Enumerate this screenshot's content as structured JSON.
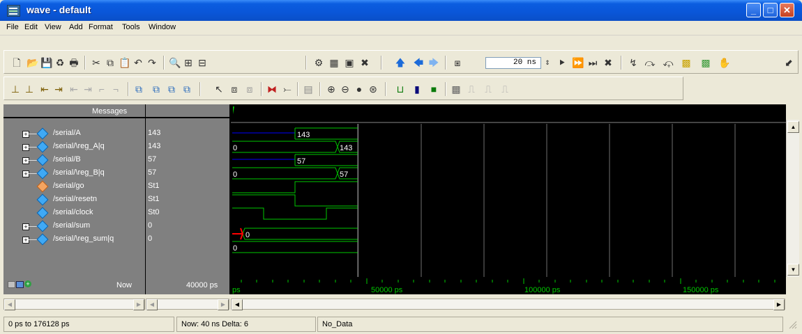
{
  "window": {
    "title": "wave - default"
  },
  "menu": [
    "File",
    "Edit",
    "View",
    "Add",
    "Format",
    "Tools",
    "Window"
  ],
  "toolbar": {
    "zoom_value": "20 ns"
  },
  "panes": {
    "messages_header": "Messages"
  },
  "signals": [
    {
      "name": "/serial/A",
      "value": "143",
      "icon": "bus-signal-icon",
      "expandable": true
    },
    {
      "name": "/serial/\\reg_A|q",
      "value": "143",
      "icon": "bus-signal-icon",
      "expandable": true
    },
    {
      "name": "/serial/B",
      "value": "57",
      "icon": "bus-signal-icon",
      "expandable": true
    },
    {
      "name": "/serial/\\reg_B|q",
      "value": "57",
      "icon": "bus-signal-icon",
      "expandable": true
    },
    {
      "name": "/serial/go",
      "value": "St1",
      "icon": "input-signal-icon",
      "expandable": false
    },
    {
      "name": "/serial/resetn",
      "value": "St1",
      "icon": "input-signal-icon",
      "expandable": false
    },
    {
      "name": "/serial/clock",
      "value": "St0",
      "icon": "input-signal-icon",
      "expandable": false
    },
    {
      "name": "/serial/sum",
      "value": "0",
      "icon": "bus-signal-icon",
      "expandable": true
    },
    {
      "name": "/serial/\\reg_sum|q",
      "value": "0",
      "icon": "bus-signal-icon",
      "expandable": true
    }
  ],
  "waves": {
    "A_label": "143",
    "reg_A_labels": [
      "0",
      "143"
    ],
    "B_label": "57",
    "reg_B_labels": [
      "0",
      "57"
    ],
    "sum_label": "0",
    "reg_sum_label": "0"
  },
  "timeline": {
    "now_label": "Now",
    "now_value": "40000 ps",
    "left_fragment": "ps",
    "ticks": [
      "50000 ps",
      "100000 ps",
      "150000 ps"
    ]
  },
  "status": {
    "range": "0 ps to 176128 ps",
    "now": "Now: 40 ns  Delta: 6",
    "data": "No_Data"
  },
  "colors": {
    "wave_green": "#00c800",
    "bus_blue": "#0000ff",
    "cursor_yellow": "#ffff00",
    "error_red": "#ff0000"
  }
}
